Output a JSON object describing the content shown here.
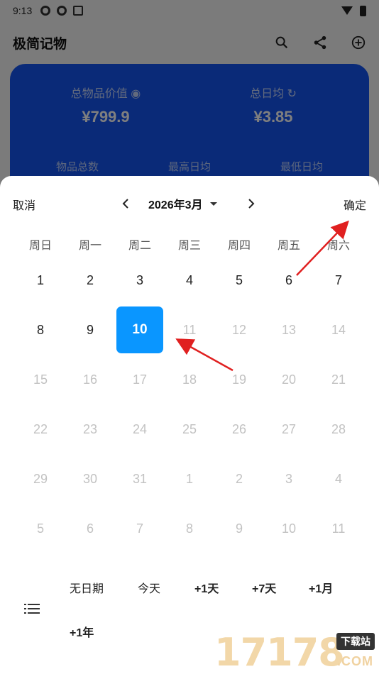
{
  "status": {
    "time": "9:13"
  },
  "app": {
    "title": "极简记物"
  },
  "card": {
    "total_label": "总物品价值",
    "total_value": "¥799.9",
    "daily_label": "总日均",
    "daily_value": "¥3.85",
    "count_label": "物品总数",
    "max_label": "最高日均",
    "min_label": "最低日均"
  },
  "picker": {
    "cancel": "取消",
    "confirm": "确定",
    "month": "2026年3月",
    "weekdays": [
      "周日",
      "周一",
      "周二",
      "周三",
      "周四",
      "周五",
      "周六"
    ],
    "days": [
      {
        "d": "1",
        "m": false
      },
      {
        "d": "2",
        "m": false
      },
      {
        "d": "3",
        "m": false
      },
      {
        "d": "4",
        "m": false
      },
      {
        "d": "5",
        "m": false
      },
      {
        "d": "6",
        "m": false
      },
      {
        "d": "7",
        "m": false
      },
      {
        "d": "8",
        "m": false
      },
      {
        "d": "9",
        "m": false
      },
      {
        "d": "10",
        "m": false,
        "sel": true
      },
      {
        "d": "11",
        "m": true
      },
      {
        "d": "12",
        "m": true
      },
      {
        "d": "13",
        "m": true
      },
      {
        "d": "14",
        "m": true
      },
      {
        "d": "15",
        "m": true
      },
      {
        "d": "16",
        "m": true
      },
      {
        "d": "17",
        "m": true
      },
      {
        "d": "18",
        "m": true
      },
      {
        "d": "19",
        "m": true
      },
      {
        "d": "20",
        "m": true
      },
      {
        "d": "21",
        "m": true
      },
      {
        "d": "22",
        "m": true
      },
      {
        "d": "23",
        "m": true
      },
      {
        "d": "24",
        "m": true
      },
      {
        "d": "25",
        "m": true
      },
      {
        "d": "26",
        "m": true
      },
      {
        "d": "27",
        "m": true
      },
      {
        "d": "28",
        "m": true
      },
      {
        "d": "29",
        "m": true
      },
      {
        "d": "30",
        "m": true
      },
      {
        "d": "31",
        "m": true
      },
      {
        "d": "1",
        "m": true
      },
      {
        "d": "2",
        "m": true
      },
      {
        "d": "3",
        "m": true
      },
      {
        "d": "4",
        "m": true
      },
      {
        "d": "5",
        "m": true
      },
      {
        "d": "6",
        "m": true
      },
      {
        "d": "7",
        "m": true
      },
      {
        "d": "8",
        "m": true
      },
      {
        "d": "9",
        "m": true
      },
      {
        "d": "10",
        "m": true
      },
      {
        "d": "11",
        "m": true
      }
    ],
    "quick": {
      "no_date": "无日期",
      "today": "今天",
      "plus_1d": "+1天",
      "plus_7d": "+7天",
      "plus_1m": "+1月",
      "plus_1y": "+1年"
    }
  },
  "watermark": {
    "num": "17178",
    "tag": "下载站",
    "com": ".COM"
  },
  "colors": {
    "accent": "#0a96ff",
    "card": "#1554f0",
    "arrow": "#e02020"
  }
}
